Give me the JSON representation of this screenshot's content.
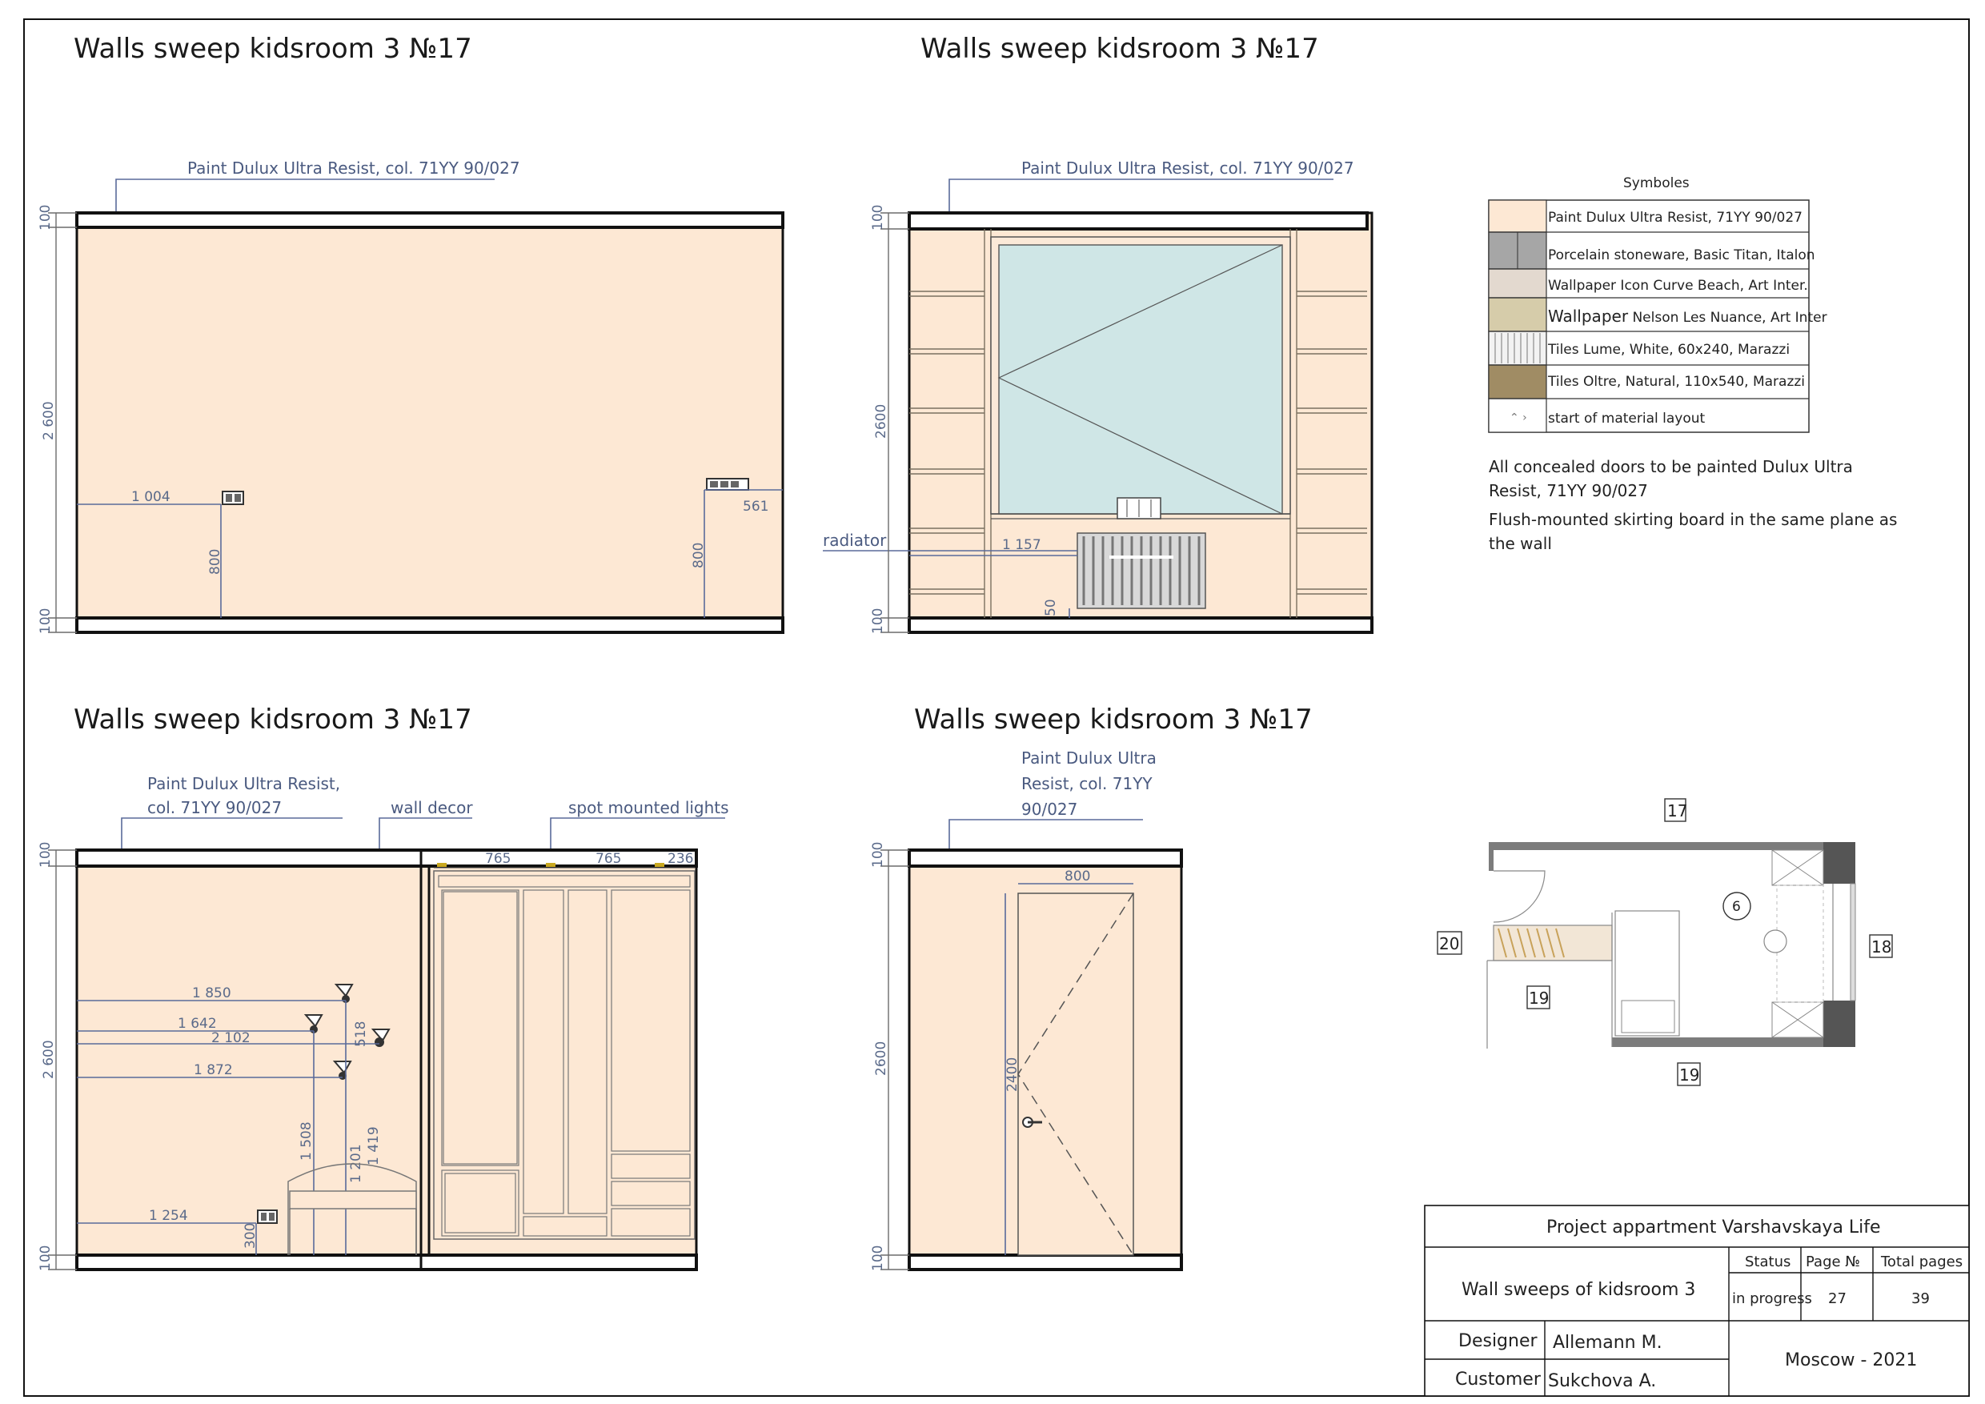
{
  "views": [
    {
      "title": "Walls sweep kidsroom 3 №17",
      "paint_note": "Paint Dulux Ultra Resist, col. 71YY 90/027",
      "dims": {
        "top": "100",
        "height": "2 600",
        "bottom": "100",
        "socket_left_x": "1 004",
        "socket_left_h": "800",
        "socket_right_x": "561",
        "socket_right_h": "800"
      }
    },
    {
      "title": "Walls sweep kidsroom 3 №17",
      "paint_note": "Paint Dulux Ultra Resist, col. 71YY 90/027",
      "radiator_label": "radiator",
      "dims": {
        "top": "100",
        "height": "2600",
        "bottom": "100",
        "radiator_x": "1 157",
        "radiator_h": "50"
      }
    },
    {
      "title": "Walls sweep kidsroom 3 №17",
      "paint_note_1": "Paint Dulux Ultra Resist,",
      "paint_note_2": "col. 71YY 90/027",
      "wall_decor": "wall decor",
      "spot_lights": "spot mounted lights",
      "dims": {
        "top": "100",
        "height": "2 600",
        "bottom": "100",
        "w1": "765",
        "w2": "765",
        "w3": "236",
        "d1850": "1 850",
        "d1642": "1 642",
        "d2102": "2 102",
        "d1872": "1 872",
        "d518": "518",
        "d1508": "1 508",
        "d1201": "1 201",
        "d1419": "1 419",
        "d1254": "1 254",
        "d300": "300"
      }
    },
    {
      "title": "Walls sweep kidsroom 3 №17",
      "paint_note_1": "Paint Dulux Ultra",
      "paint_note_2": "Resist, col. 71YY",
      "paint_note_3": "90/027",
      "dims": {
        "top": "100",
        "height": "2600",
        "bottom": "100",
        "door_w": "800",
        "door_h": "2400"
      }
    }
  ],
  "legend": {
    "title": "Symboles",
    "items": [
      {
        "label": "Paint Dulux Ultra Resist, 71YY 90/027",
        "color": "#fde8d4"
      },
      {
        "label": "Porcelain stoneware, Basic Titan, Italon",
        "color": "#a6a6a6"
      },
      {
        "label": "Wallpaper Icon Curve Beach, Art  Inter.",
        "color": "#e3d9cf"
      },
      {
        "label_big": "Wallpaper",
        "label": " Nelson Les Nuance, Art Inter",
        "color": "#d6ccaa"
      },
      {
        "label": "Tiles Lume, White, 60x240, Marazzi",
        "color": "#f2f2f2"
      },
      {
        "label": "Tiles Oltre, Natural, 110x540, Marazzi",
        "color": "#a08c64"
      },
      {
        "label": "start of material layout",
        "color": "#ffffff"
      }
    ]
  },
  "notes": {
    "line1": "All concealed doors to be painted Dulux Ultra",
    "line2": "Resist, 71YY 90/027",
    "line3": "Flush-mounted skirting board in the same plane as",
    "line4": "the wall"
  },
  "plan": {
    "wall_17": "17",
    "wall_18": "18",
    "wall_19a": "19",
    "wall_19b": "19",
    "wall_20": "20",
    "marker": "6"
  },
  "title_block": {
    "project": "Project appartment Varshavskaya Life",
    "sheet_name": "Wall sweeps of kidsroom 3",
    "status_label": "Status",
    "page_label": "Page №",
    "total_label": "Total pages",
    "status_value": "in progress",
    "page_value": "27",
    "total_value": "39",
    "designer_label": "Designer",
    "designer_value": "Allemann M.",
    "customer_label": "Customer",
    "customer_value": "Sukchova A.",
    "city_year": "Moscow - 2021"
  }
}
